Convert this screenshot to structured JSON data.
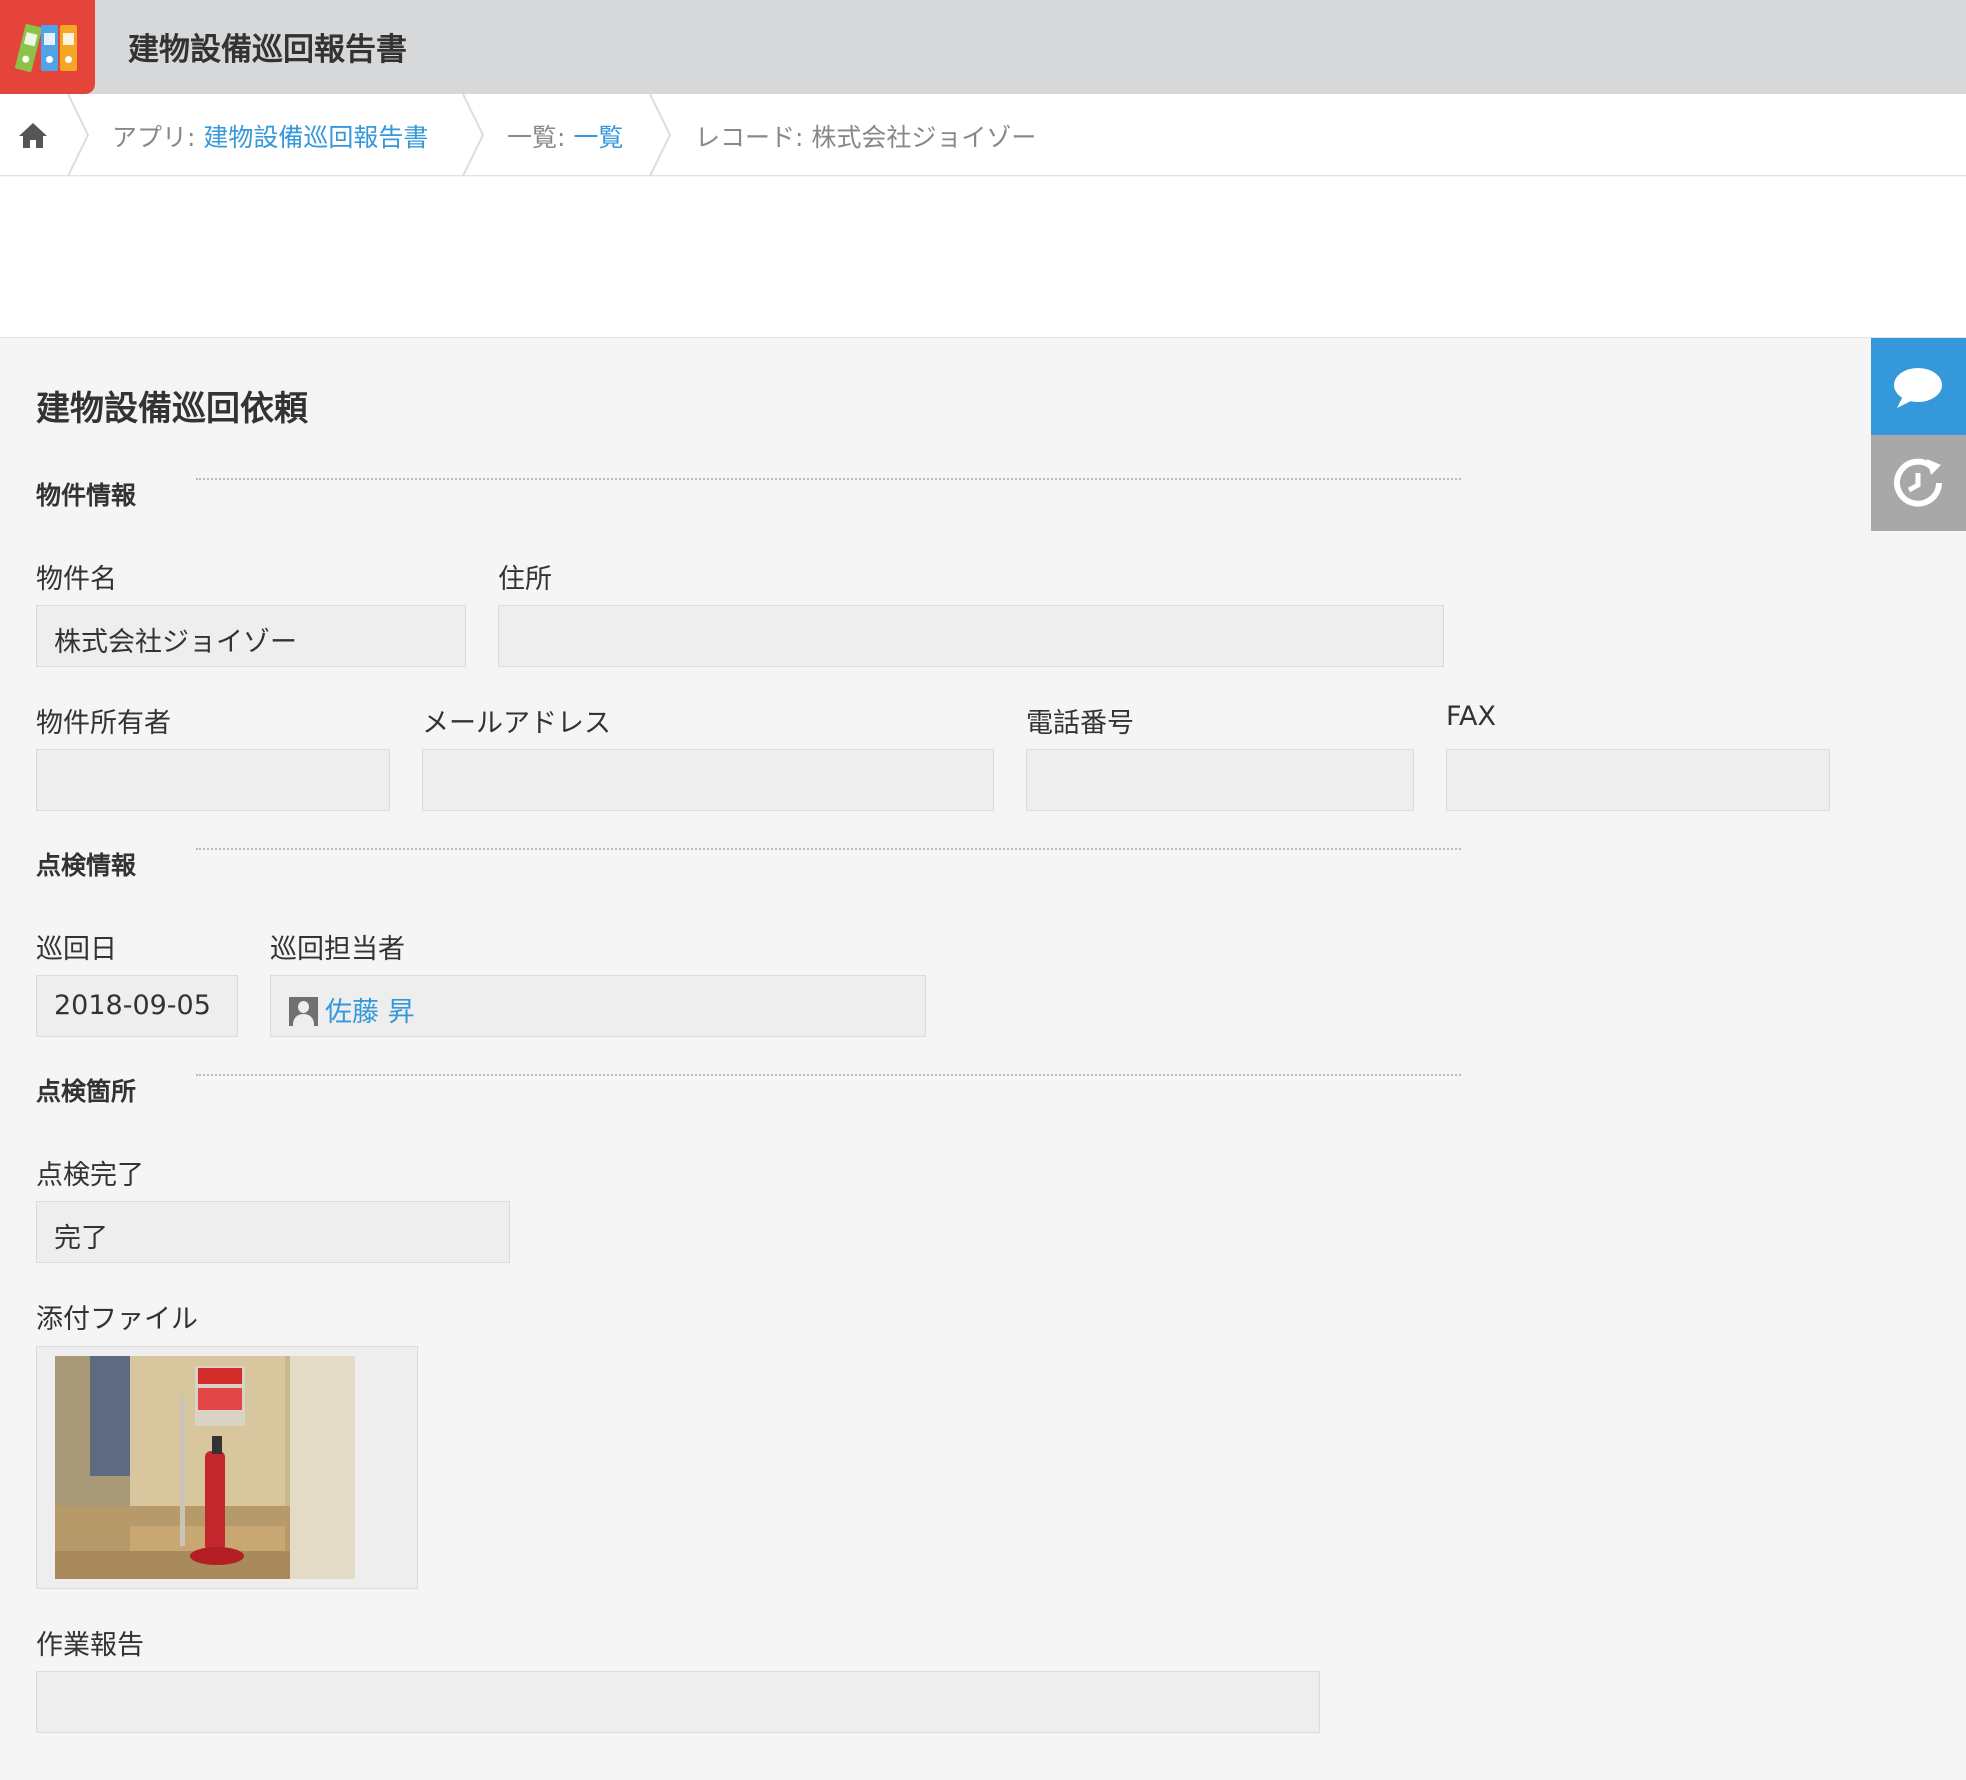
{
  "app": {
    "title": "建物設備巡回報告書",
    "icon": "binders-app-icon"
  },
  "breadcrumb": {
    "home_icon": "home-icon",
    "app_prefix": "アプリ: ",
    "app_link": "建物設備巡回報告書",
    "list_prefix": "一覧: ",
    "list_link": "一覧",
    "record_text": "レコード: 株式会社ジョイゾー"
  },
  "side_tabs": {
    "comment_icon": "comment-icon",
    "history_icon": "history-icon"
  },
  "form": {
    "title": "建物設備巡回依頼",
    "sections": {
      "property": "物件情報",
      "inspection": "点検情報",
      "locations": "点検箇所"
    },
    "fields": {
      "property_name": {
        "label": "物件名",
        "value": "株式会社ジョイゾー"
      },
      "address": {
        "label": "住所",
        "value": ""
      },
      "owner": {
        "label": "物件所有者",
        "value": ""
      },
      "email": {
        "label": "メールアドレス",
        "value": ""
      },
      "phone": {
        "label": "電話番号",
        "value": ""
      },
      "fax": {
        "label": "FAX",
        "value": ""
      },
      "patrol_date": {
        "label": "巡回日",
        "value": "2018-09-05"
      },
      "patrol_staff": {
        "label": "巡回担当者",
        "value": "佐藤 昇"
      },
      "inspection_done": {
        "label": "点検完了",
        "value": "完了"
      },
      "attachment": {
        "label": "添付ファイル"
      },
      "work_report": {
        "label": "作業報告",
        "value": ""
      }
    }
  },
  "colors": {
    "header_bg": "#d6d8d9",
    "link": "#3498db",
    "comment_tab": "#3498db",
    "history_tab": "#a8a8a8",
    "app_icon_bg": "#e5443a"
  }
}
